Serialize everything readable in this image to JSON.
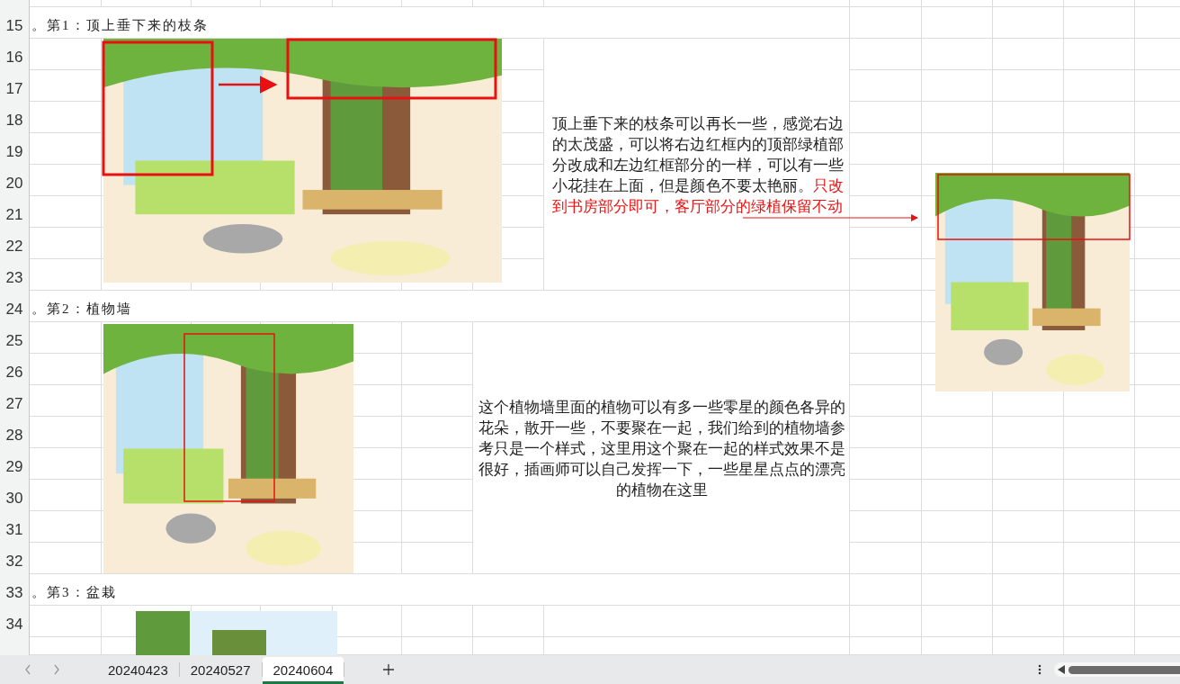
{
  "row_headers": [
    "15",
    "16",
    "17",
    "18",
    "19",
    "20",
    "21",
    "22",
    "23",
    "24",
    "25",
    "26",
    "27",
    "28",
    "29",
    "30",
    "31",
    "32",
    "33",
    "34"
  ],
  "sections": [
    {
      "title": "。第1：顶上垂下来的枝条",
      "comment": [
        {
          "kind": "normal",
          "text": "顶上垂下来的枝条可以再长一些，感觉右边的太茂盛，可以将右边红框内的顶部绿植部分改成和左边红框部分的一样，可以有一些小花挂在上面，但是颜色不要太艳丽。"
        },
        {
          "kind": "highlight",
          "text": "只改到书房部分即可，客厅部分的绿植保留不动"
        }
      ]
    },
    {
      "title": "。第2：植物墙",
      "comment": [
        {
          "kind": "normal",
          "text": "这个植物墙里面的植物可以有多一些零星的颜色各异的花朵，散开一些，不要聚在一起，我们给到的植物墙参考只是一个样式，这里用这个聚在一起的样式效果不是很好，插画师可以自己发挥一下，一些星星点点的漂亮的植物在这里"
        }
      ]
    },
    {
      "title": "。第3：盆栽"
    }
  ],
  "sheet_tabs": [
    {
      "label": "20240423",
      "selected": false
    },
    {
      "label": "20240527",
      "selected": false
    },
    {
      "label": "20240604",
      "selected": true
    }
  ]
}
